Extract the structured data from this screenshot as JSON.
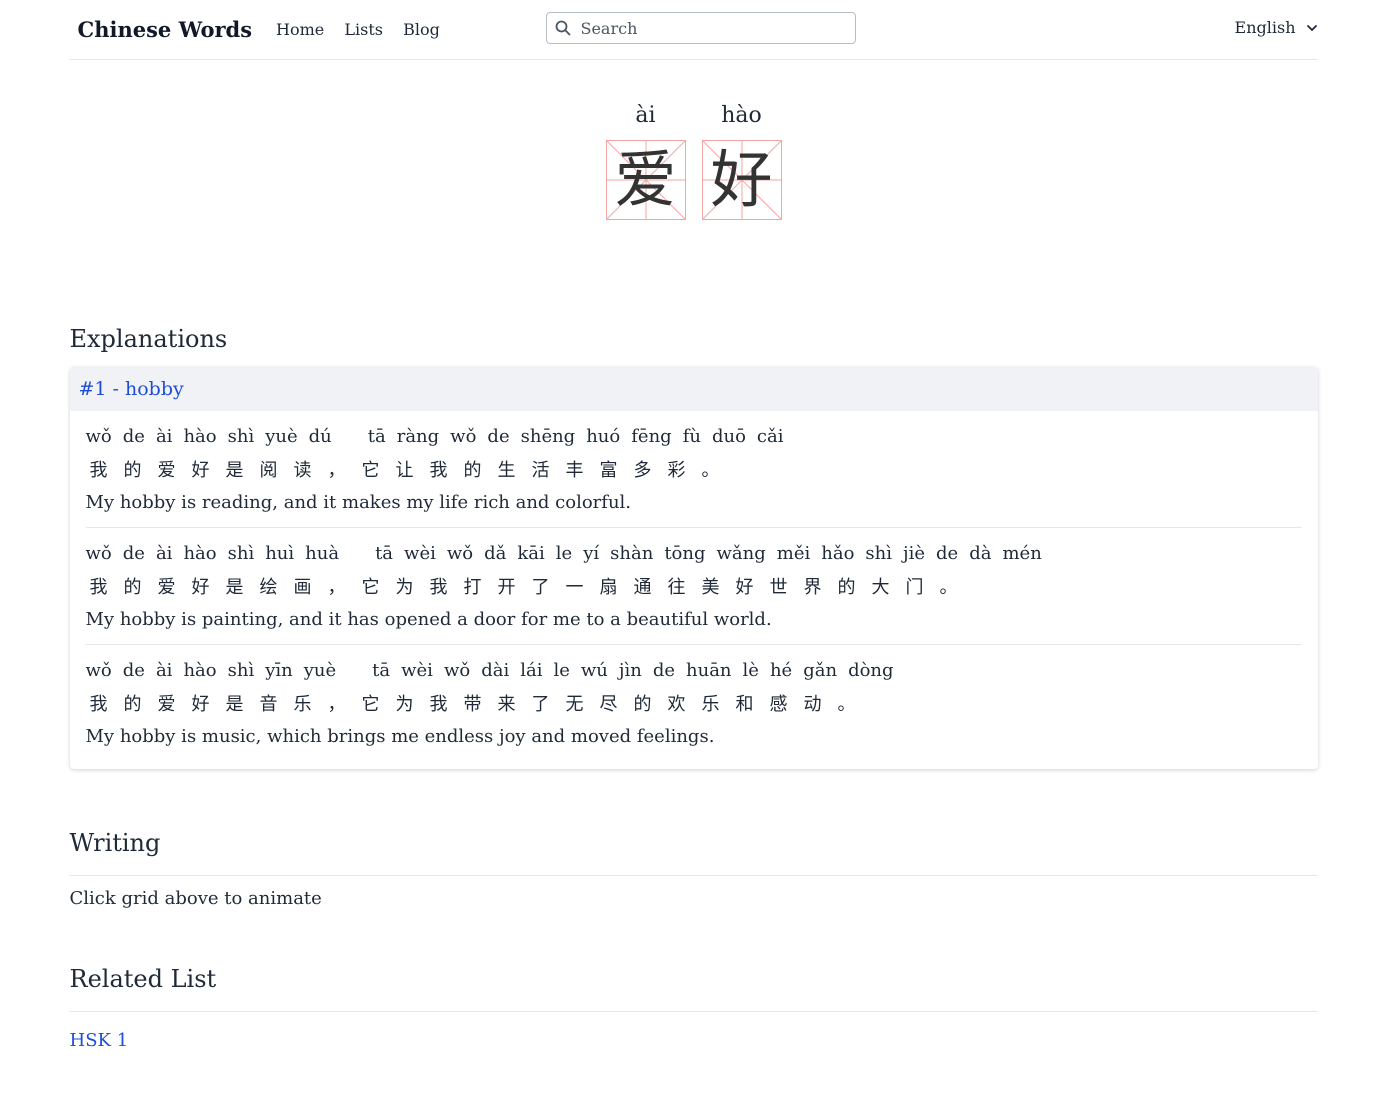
{
  "header": {
    "brand": "Chinese Words",
    "nav": [
      "Home",
      "Lists",
      "Blog"
    ],
    "search_placeholder": "Search",
    "language": "English"
  },
  "word": {
    "chars": [
      {
        "pinyin": "ài",
        "hanzi": "爱"
      },
      {
        "pinyin": "hào",
        "hanzi": "好"
      }
    ]
  },
  "explanations": {
    "title": "Explanations",
    "items": [
      {
        "heading": "#1 - hobby",
        "examples": [
          {
            "pinyin": [
              "wǒ",
              "de",
              "ài",
              "hào",
              "shì",
              "yuè",
              "dú",
              "",
              "tā",
              "ràng",
              "wǒ",
              "de",
              "shēng",
              "huó",
              "fēng",
              "fù",
              "duō",
              "cǎi"
            ],
            "chars": [
              "我",
              "的",
              "爱",
              "好",
              "是",
              "阅",
              "读",
              "，",
              "它",
              "让",
              "我",
              "的",
              "生",
              "活",
              "丰",
              "富",
              "多",
              "彩",
              "。"
            ],
            "translation": "My hobby is reading, and it makes my life rich and colorful."
          },
          {
            "pinyin": [
              "wǒ",
              "de",
              "ài",
              "hào",
              "shì",
              "huì",
              "huà",
              "",
              "tā",
              "wèi",
              "wǒ",
              "dǎ",
              "kāi",
              "le",
              "yí",
              "shàn",
              "tōng",
              "wǎng",
              "měi",
              "hǎo",
              "shì",
              "jiè",
              "de",
              "dà",
              "mén"
            ],
            "chars": [
              "我",
              "的",
              "爱",
              "好",
              "是",
              "绘",
              "画",
              "，",
              "它",
              "为",
              "我",
              "打",
              "开",
              "了",
              "一",
              "扇",
              "通",
              "往",
              "美",
              "好",
              "世",
              "界",
              "的",
              "大",
              "门",
              "。"
            ],
            "translation": "My hobby is painting, and it has opened a door for me to a beautiful world."
          },
          {
            "pinyin": [
              "wǒ",
              "de",
              "ài",
              "hào",
              "shì",
              "yīn",
              "yuè",
              "",
              "tā",
              "wèi",
              "wǒ",
              "dài",
              "lái",
              "le",
              "wú",
              "jìn",
              "de",
              "huān",
              "lè",
              "hé",
              "gǎn",
              "dòng"
            ],
            "chars": [
              "我",
              "的",
              "爱",
              "好",
              "是",
              "音",
              "乐",
              "，",
              "它",
              "为",
              "我",
              "带",
              "来",
              "了",
              "无",
              "尽",
              "的",
              "欢",
              "乐",
              "和",
              "感",
              "动",
              "。"
            ],
            "translation": "My hobby is music, which brings me endless joy and moved feelings."
          }
        ]
      }
    ]
  },
  "writing": {
    "title": "Writing",
    "hint": "Click grid above to animate"
  },
  "related": {
    "title": "Related List",
    "link": "HSK 1"
  },
  "colors": {
    "link": "#1d4ed8",
    "grid_line": "#f3a6a6",
    "card_head_bg": "#f1f2f5"
  }
}
